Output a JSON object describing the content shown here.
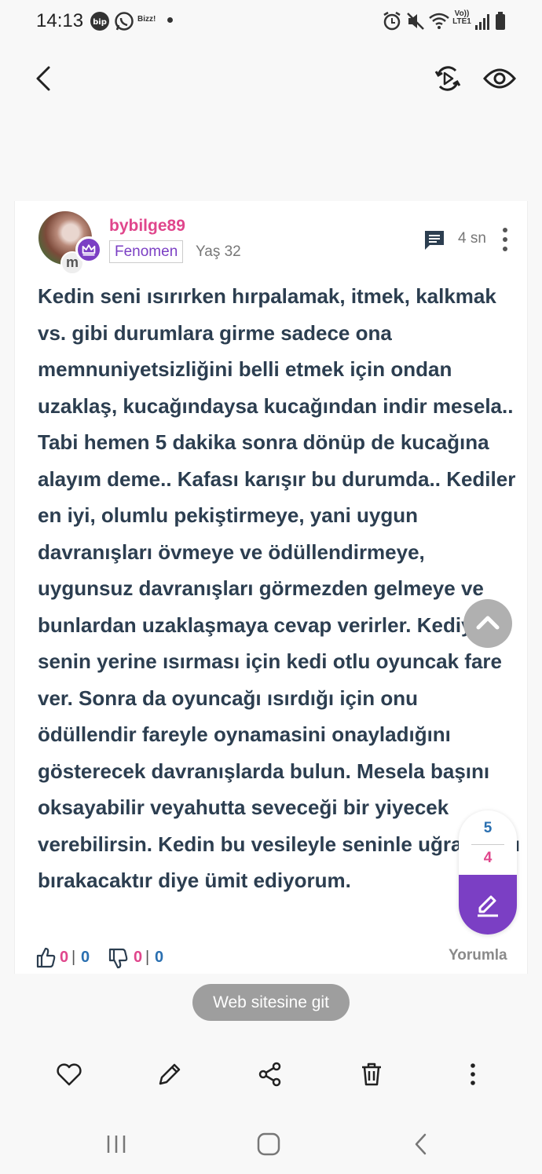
{
  "status_bar": {
    "time": "14:13",
    "carrier_label": "Bizz!",
    "network_label": "Vo)) LTE1",
    "icons": [
      "bip-icon",
      "whatsapp-icon",
      "alarm-icon",
      "mute-icon",
      "wifi-icon",
      "signal-icon",
      "battery-icon"
    ]
  },
  "post": {
    "username": "bybilge89",
    "avatar_letter": "m",
    "badge": "Fenomen",
    "age": "Yaş 32",
    "time_ago": "4 sn",
    "text": "Kedin seni ısırırken hırpalamak, itmek, kalkmak vs. gibi durumlara girme sadece ona memnuniyetsizliğini belli etmek için ondan uzaklaş, kucağındaysa kucağından indir mesela.. Tabi hemen 5 dakika sonra dönüp de kucağına alayım deme.. Kafası karışır bu durumda.. Kediler en iyi, olumlu pekiştirmeye, yani uygun davranışları övmeye ve ödüllendirmeye, uygunsuz davranışları görmezden gelmeye ve bunlardan uzaklaşmaya cevap verirler. Kediye, senin yerine ısırması için kedi otlu oyuncak fare ver. Sonra da oyuncağı ısırdığı için onu ödüllendir fareyle oynamasini onayladığını gösterecek davranışlarda bulun. Mesela başını oksayabilir veyahutta seveceği bir yiyecek verebilirsin. Kedin bu vesileyle seninle uğraşmayı bırakacaktır diye ümit ediyorum.",
    "likes": {
      "pink": "0",
      "sep": "|",
      "blue": "0"
    },
    "dislikes": {
      "pink": "0",
      "sep": "|",
      "blue": "0"
    },
    "reply_label": "Yorumla"
  },
  "pager": {
    "total": "5",
    "current": "4"
  },
  "web_button": "Web sitesine git",
  "colors": {
    "accent_purple": "#7b3fc4",
    "accent_pink": "#e0468c",
    "accent_blue": "#2a6fb0",
    "text": "#2c3e50"
  }
}
